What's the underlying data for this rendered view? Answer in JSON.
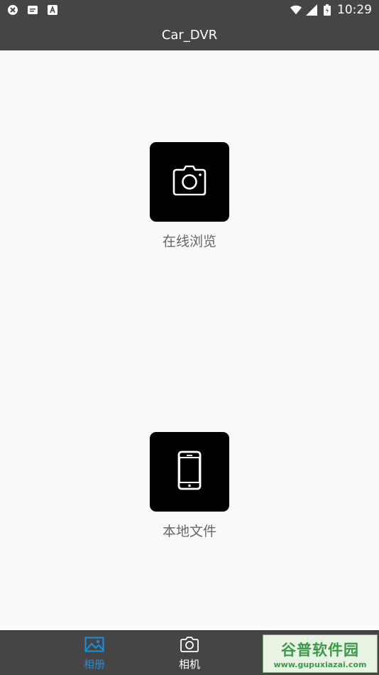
{
  "status_bar": {
    "time": "10:29",
    "left_icons": [
      "sync-icon",
      "message-icon",
      "a-icon"
    ],
    "right_icons": [
      "wifi-icon",
      "signal-icon",
      "battery-icon"
    ]
  },
  "app_bar": {
    "title": "Car_DVR"
  },
  "main": {
    "online_browse": {
      "label": "在线浏览",
      "icon": "camera-icon"
    },
    "local_files": {
      "label": "本地文件",
      "icon": "phone-icon"
    }
  },
  "bottom_nav": {
    "items": [
      {
        "label": "相册",
        "icon": "album-icon",
        "active": true
      },
      {
        "label": "相机",
        "icon": "camera-icon",
        "active": false
      }
    ]
  },
  "watermark": {
    "main": "谷普软件园",
    "sub": "www.gupuxiazai.com"
  },
  "colors": {
    "bar": "#454545",
    "accent": "#1b8fe0",
    "tile": "#000000",
    "label": "#666666"
  }
}
